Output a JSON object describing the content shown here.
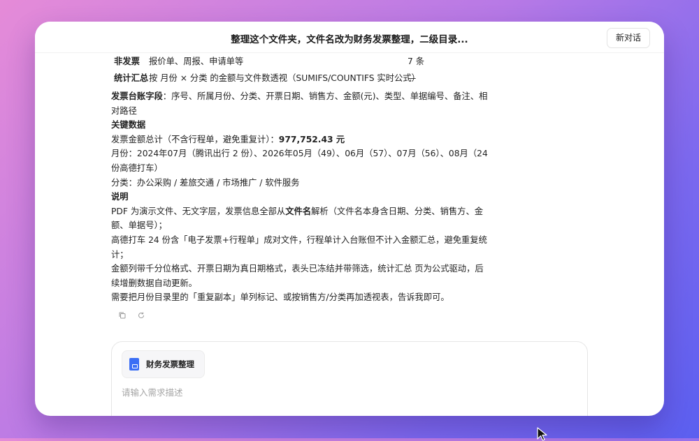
{
  "header": {
    "title": "整理这个文件夹，文件名改为财务发票整理，二级目录...",
    "new_chat_label": "新对话"
  },
  "table_rows": [
    {
      "label": "非发票",
      "desc": "报价单、周报、申请单等",
      "count": "7 条"
    },
    {
      "label": "统计汇总",
      "desc": "按 月份 × 分类 的金额与文件数透视（SUMIFS/COUNTIFS 实时公式）",
      "count": "—"
    }
  ],
  "fields": {
    "label": "发票台账字段",
    "text": "：序号、所属月份、分类、开票日期、销售方、金额(元)、类型、单据编号、备注、相对路径"
  },
  "key_data": {
    "heading": "关键数据",
    "total_prefix": "发票金额总计（不含行程单，避免重复计）：",
    "total_value": "977,752.43 元",
    "months": "月份：2024年07月（腾讯出行 2 份）、2026年05月（49）、06月（57）、07月（56）、08月（24份高德打车）",
    "categories": "分类：办公采购 / 差旅交通 / 市场推广 / 软件服务"
  },
  "notes": {
    "heading": "说明",
    "line1_prefix": "PDF 为演示文件、无文字层，发票信息全部从",
    "line1_bold": "文件名",
    "line1_suffix": "解析（文件名本身含日期、分类、销售方、金额、单据号）；",
    "line2": "高德打车 24 份含「电子发票+行程单」成对文件，行程单计入台账但不计入金额汇总，避免重复统计；",
    "line3": "金额列带千分位格式、开票日期为真日期格式，表头已冻结并带筛选，统计汇总 页为公式驱动，后续增删数据自动更新。",
    "line4": "需要把月份目录里的「重复副本」单列标记、或按销售方/分类再加透视表，告诉我即可。"
  },
  "composer": {
    "file_chip_label": "财务发票整理",
    "placeholder": "请输入需求描述"
  }
}
